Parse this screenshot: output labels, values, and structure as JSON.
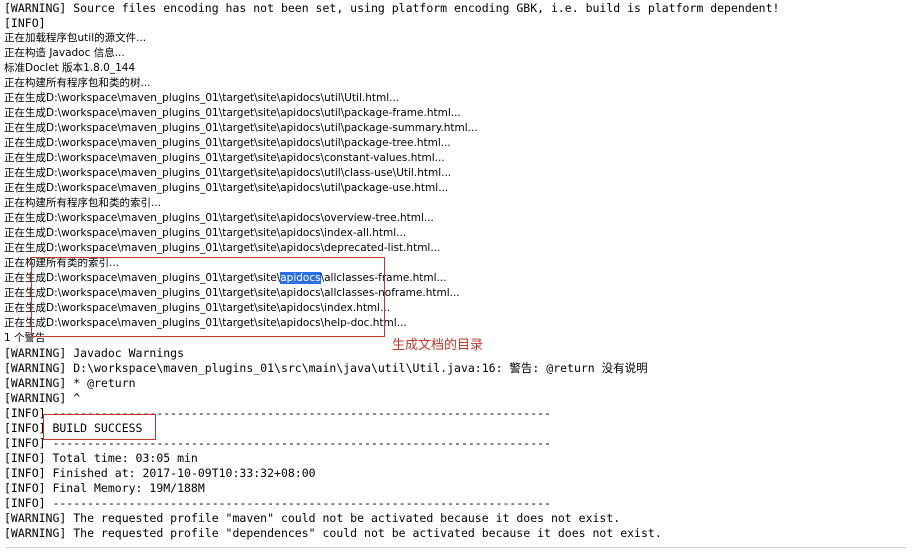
{
  "console": {
    "name": "maven-build-console-output",
    "lines": [
      {
        "id": "l0",
        "text": "[WARNING] Source files encoding has not been set, using platform encoding GBK, i.e. build is platform dependent!",
        "cjk": false
      },
      {
        "id": "l1",
        "text": "[INFO]",
        "cjk": false
      },
      {
        "id": "l2",
        "text": "正在加载程序包util的源文件...",
        "cjk": true
      },
      {
        "id": "l3",
        "text": "正在构造 Javadoc 信息...",
        "cjk": true
      },
      {
        "id": "l4",
        "text": "标准Doclet 版本1.8.0_144",
        "cjk": true
      },
      {
        "id": "l5",
        "text": "正在构建所有程序包和类的树...",
        "cjk": true
      },
      {
        "id": "l6",
        "text": "正在生成D:\\workspace\\maven_plugins_01\\target\\site\\apidocs\\util\\Util.html...",
        "cjk": true
      },
      {
        "id": "l7",
        "text": "正在生成D:\\workspace\\maven_plugins_01\\target\\site\\apidocs\\util\\package-frame.html...",
        "cjk": true
      },
      {
        "id": "l8",
        "text": "正在生成D:\\workspace\\maven_plugins_01\\target\\site\\apidocs\\util\\package-summary.html...",
        "cjk": true
      },
      {
        "id": "l9",
        "text": "正在生成D:\\workspace\\maven_plugins_01\\target\\site\\apidocs\\util\\package-tree.html...",
        "cjk": true
      },
      {
        "id": "l10",
        "text": "正在生成D:\\workspace\\maven_plugins_01\\target\\site\\apidocs\\constant-values.html...",
        "cjk": true
      },
      {
        "id": "l11",
        "text": "正在生成D:\\workspace\\maven_plugins_01\\target\\site\\apidocs\\util\\class-use\\Util.html...",
        "cjk": true
      },
      {
        "id": "l12",
        "text": "正在生成D:\\workspace\\maven_plugins_01\\target\\site\\apidocs\\util\\package-use.html...",
        "cjk": true
      },
      {
        "id": "l13",
        "text": "正在构建所有程序包和类的索引...",
        "cjk": true
      },
      {
        "id": "l14",
        "text": "正在生成D:\\workspace\\maven_plugins_01\\target\\site\\apidocs\\overview-tree.html...",
        "cjk": true
      },
      {
        "id": "l15",
        "text": "正在生成D:\\workspace\\maven_plugins_01\\target\\site\\apidocs\\index-all.html...",
        "cjk": true
      },
      {
        "id": "l16",
        "text": "正在生成D:\\workspace\\maven_plugins_01\\target\\site\\apidocs\\deprecated-list.html...",
        "cjk": true
      },
      {
        "id": "l17",
        "text": "正在构建所有类的索引...",
        "cjk": true
      },
      {
        "id": "l18",
        "selection": {
          "before": "正在生成D:\\workspace\\maven_plugins_01\\target\\site\\",
          "highlight": "apidocs",
          "after": "\\allclasses-frame.html..."
        },
        "cjk": true
      },
      {
        "id": "l19",
        "text": "正在生成D:\\workspace\\maven_plugins_01\\target\\site\\apidocs\\allclasses-noframe.html...",
        "cjk": true
      },
      {
        "id": "l20",
        "text": "正在生成D:\\workspace\\maven_plugins_01\\target\\site\\apidocs\\index.html...",
        "cjk": true
      },
      {
        "id": "l21",
        "text": "正在生成D:\\workspace\\maven_plugins_01\\target\\site\\apidocs\\help-doc.html...",
        "cjk": true
      },
      {
        "id": "l22",
        "text": "1 个警告",
        "cjk": true
      },
      {
        "id": "l23",
        "text": "[WARNING] Javadoc Warnings",
        "cjk": false
      },
      {
        "id": "l24",
        "text": "[WARNING] D:\\workspace\\maven_plugins_01\\src\\main\\java\\util\\Util.java:16: 警告: @return 没有说明",
        "cjk": false
      },
      {
        "id": "l25",
        "text": "[WARNING] * @return",
        "cjk": false
      },
      {
        "id": "l26",
        "text": "[WARNING] ^",
        "cjk": false
      },
      {
        "id": "l27",
        "text": "[INFO] ------------------------------------------------------------------------",
        "cjk": false
      },
      {
        "id": "l28",
        "text": "[INFO] BUILD SUCCESS",
        "cjk": false
      },
      {
        "id": "l29",
        "text": "[INFO] ------------------------------------------------------------------------",
        "cjk": false
      },
      {
        "id": "l30",
        "text": "[INFO] Total time: 03:05 min",
        "cjk": false
      },
      {
        "id": "l31",
        "text": "[INFO] Finished at: 2017-10-09T10:33:32+08:00",
        "cjk": false
      },
      {
        "id": "l32",
        "text": "[INFO] Final Memory: 19M/188M",
        "cjk": false
      },
      {
        "id": "l33",
        "text": "[INFO] ------------------------------------------------------------------------",
        "cjk": false
      },
      {
        "id": "l34",
        "text": "[WARNING] The requested profile \"maven\" could not be activated because it does not exist.",
        "cjk": false
      },
      {
        "id": "l35",
        "text": "[WARNING] The requested profile \"dependences\" could not be activated because it does not exist.",
        "cjk": false
      }
    ]
  },
  "annotations": {
    "generated_docs_directory_label": "生成文档的目录",
    "box_apidocs_name": "apidocs-output-paths-highlight-box",
    "box_build_success_name": "build-success-highlight-box",
    "accent_color": "#c0392b",
    "selection_color": "#2a6ee8"
  },
  "selection": {
    "selected_text": "apidocs"
  }
}
